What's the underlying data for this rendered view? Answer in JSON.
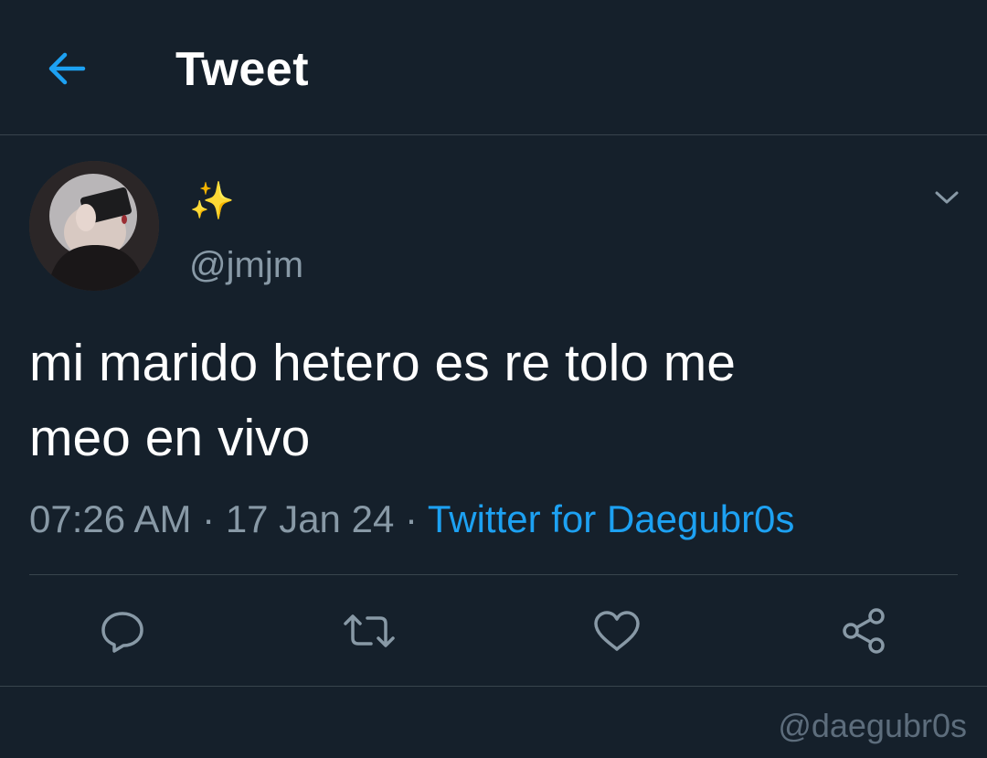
{
  "header": {
    "title": "Tweet",
    "back_icon": "arrow-left-icon"
  },
  "tweet": {
    "display_name": "✨",
    "handle": "@jmjm",
    "text_line1": "mi marido hetero es re tolo me",
    "text_line2": "meo en vivo",
    "time": "07:26 AM",
    "date": "17 Jan 24",
    "separator": "·",
    "source": "Twitter for Daegubr0s"
  },
  "actions": {
    "reply_icon": "reply-icon",
    "retweet_icon": "retweet-icon",
    "like_icon": "heart-icon",
    "share_icon": "share-icon"
  },
  "watermark": "@daegubr0s",
  "colors": {
    "background": "#15202b",
    "accent": "#1da1f2",
    "muted": "#8899a6",
    "divider": "#38444d"
  }
}
